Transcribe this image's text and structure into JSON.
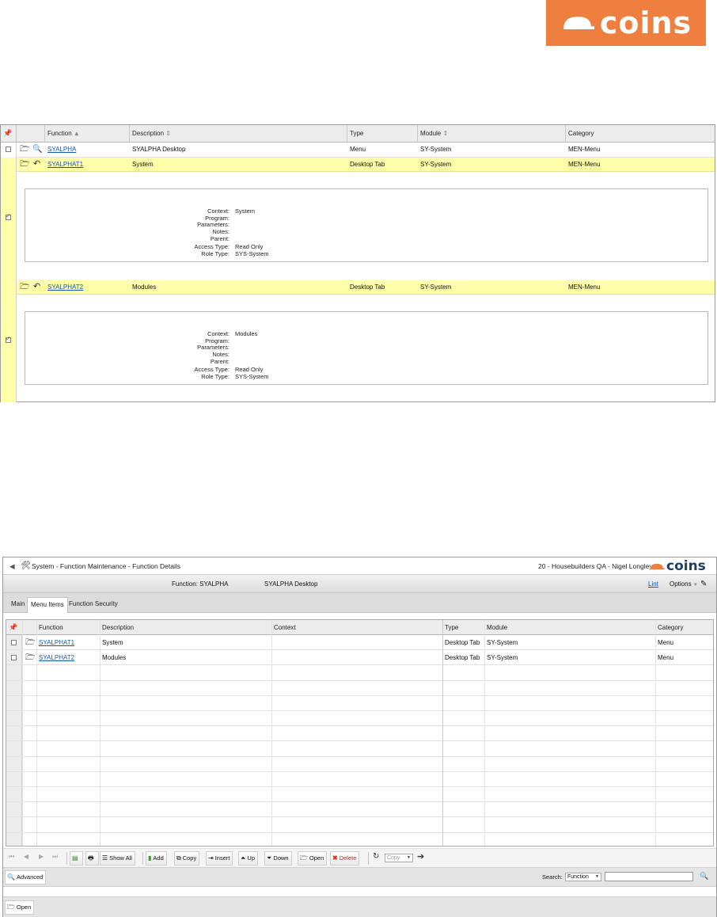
{
  "logo": {
    "text": "coins"
  },
  "top_grid": {
    "columns": [
      "Function",
      "Description",
      "Type",
      "Module",
      "Category"
    ],
    "rows": [
      {
        "function": "SYALPHA",
        "description": "SYALPHA Desktop",
        "type": "Menu",
        "module": "SY-System",
        "category": "MEN-Menu"
      },
      {
        "function": "SYALPHAT1",
        "description": "System",
        "type": "Desktop Tab",
        "module": "SY-System",
        "category": "MEN-Menu",
        "details": {
          "context_label": "Context:",
          "context": "System",
          "program_label": "Program:",
          "parameters_label": "Parameters:",
          "notes_label": "Notes:",
          "parent_label": "Parent:",
          "access_label": "Access Type:",
          "access": "Read Only",
          "role_label": "Role Type:",
          "role": "SYS-System"
        }
      },
      {
        "function": "SYALPHAT2",
        "description": "Modules",
        "type": "Desktop Tab",
        "module": "SY-System",
        "category": "MEN-Menu",
        "details": {
          "context_label": "Context:",
          "context": "Modules",
          "program_label": "Program:",
          "parameters_label": "Parameters:",
          "notes_label": "Notes:",
          "parent_label": "Parent:",
          "access_label": "Access Type:",
          "access": "Read Only",
          "role_label": "Role Type:",
          "role": "SYS-System"
        }
      }
    ]
  },
  "app": {
    "title": "System - Function Maintenance - Function Details",
    "user": "20 - Housebuilders QA - Nigel Longley",
    "logo_text": "coins",
    "function_label": "Function: SYALPHA",
    "function_desc": "SYALPHA Desktop",
    "lint": "Lint",
    "options": "Options",
    "tabs": [
      "Main",
      "Menu Items",
      "Function Security"
    ],
    "grid": {
      "columns": [
        "Function",
        "Description",
        "Context",
        "Type",
        "Module",
        "Category"
      ],
      "rows": [
        {
          "function": "SYALPHAT1",
          "description": "System",
          "context": "",
          "type": "Desktop Tab",
          "module": "SY-System",
          "category": "Menu"
        },
        {
          "function": "SYALPHAT2",
          "description": "Modules",
          "context": "",
          "type": "Desktop Tab",
          "module": "SY-System",
          "category": "Menu"
        }
      ]
    },
    "toolbar": {
      "show_all": "Show All",
      "add": "Add",
      "copy": "Copy",
      "insert": "Insert",
      "up": "Up",
      "down": "Down",
      "open": "Open",
      "delete": "Delete",
      "copy_select": "Copy"
    },
    "search": {
      "advanced": "Advanced",
      "label": "Search:",
      "field": "Function",
      "value": ""
    },
    "bottom": {
      "open": "Open"
    }
  }
}
